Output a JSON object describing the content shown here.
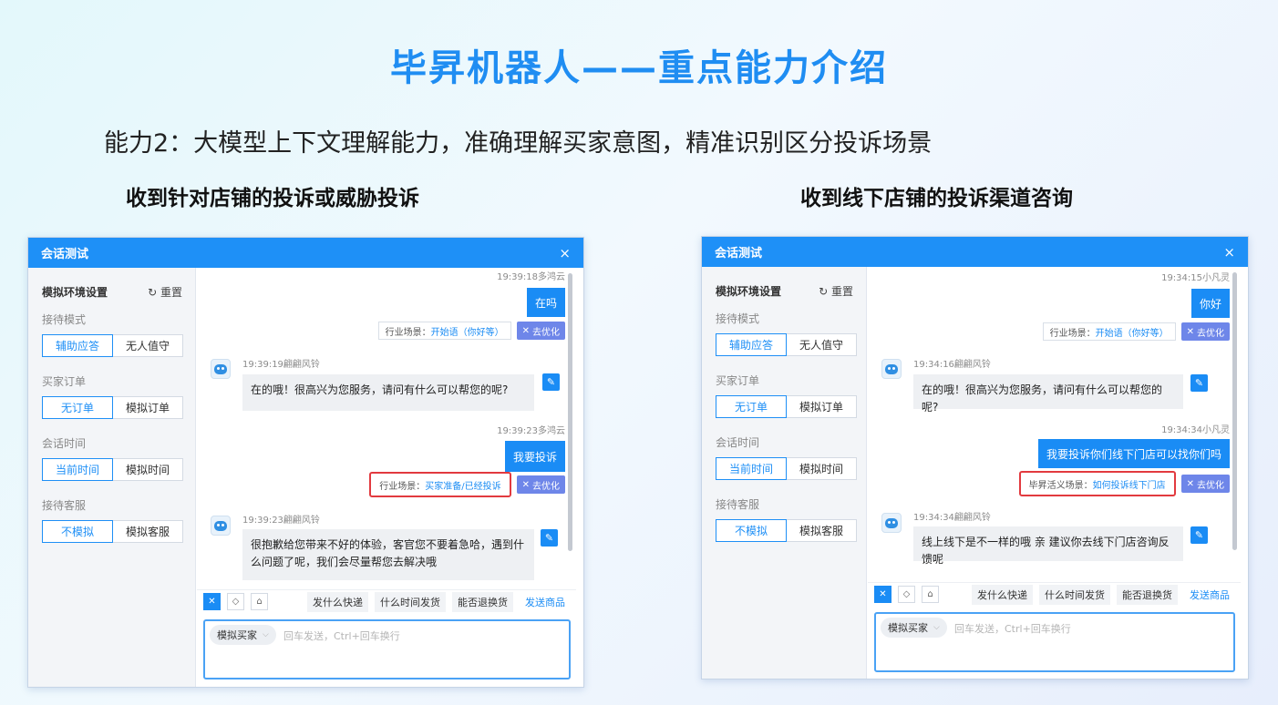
{
  "slide": {
    "title": "毕昇机器人——重点能力介绍",
    "subtitle": "能力2：大模型上下文理解能力，准确理解买家意图，精准识别区分投诉场景",
    "caption_left": "收到针对店铺的投诉或威胁投诉",
    "caption_right": "收到线下店铺的投诉渠道咨询"
  },
  "panels": [
    {
      "title": "会话测试",
      "close": "×",
      "sidebar": {
        "heading": "模拟环境设置",
        "reset": "重置",
        "groups": [
          {
            "label": "接待模式",
            "options": [
              "辅助应答",
              "无人值守"
            ]
          },
          {
            "label": "买家订单",
            "options": [
              "无订单",
              "模拟订单"
            ]
          },
          {
            "label": "会话时间",
            "options": [
              "当前时间",
              "模拟时间"
            ]
          },
          {
            "label": "接待客服",
            "options": [
              "不模拟",
              "模拟客服"
            ]
          }
        ]
      },
      "messages": [
        {
          "role": "buyer",
          "time": "19:39:18多鸿云",
          "text": "在吗",
          "scene_label": "行业场景：",
          "scene_value": "开始语（你好等）",
          "optimize": "去优化"
        },
        {
          "role": "bot",
          "time": "19:39:19翩翩风铃",
          "text": "在的哦！很高兴为您服务，请问有什么可以帮您的呢?"
        },
        {
          "role": "buyer",
          "time": "19:39:23多鸿云",
          "text": "我要投诉",
          "scene_label": "行业场景：",
          "scene_value": "买家准备/已经投诉",
          "optimize": "去优化"
        },
        {
          "role": "bot",
          "time": "19:39:23翩翩风铃",
          "text": "很抱歉给您带来不好的体验，客官您不要着急哈，遇到什么问题了呢，我们会尽量帮您去解决哦"
        }
      ],
      "quick_replies": [
        "发什么快递",
        "什么时间发货",
        "能否退换货"
      ],
      "send_goods": "发送商品",
      "buyer_select": "模拟买家",
      "input_placeholder": "回车发送，Ctrl+回车换行"
    },
    {
      "title": "会话测试",
      "close": "×",
      "sidebar": {
        "heading": "模拟环境设置",
        "reset": "重置",
        "groups": [
          {
            "label": "接待模式",
            "options": [
              "辅助应答",
              "无人值守"
            ]
          },
          {
            "label": "买家订单",
            "options": [
              "无订单",
              "模拟订单"
            ]
          },
          {
            "label": "会话时间",
            "options": [
              "当前时间",
              "模拟时间"
            ]
          },
          {
            "label": "接待客服",
            "options": [
              "不模拟",
              "模拟客服"
            ]
          }
        ]
      },
      "messages": [
        {
          "role": "buyer",
          "time": "19:34:15小凡灵",
          "text": "你好",
          "scene_label": "行业场景：",
          "scene_value": "开始语（你好等）",
          "optimize": "去优化"
        },
        {
          "role": "bot",
          "time": "19:34:16翩翩风铃",
          "text": "在的哦！很高兴为您服务，请问有什么可以帮您的呢?"
        },
        {
          "role": "buyer",
          "time": "19:34:34小凡灵",
          "text": "我要投诉你们线下门店可以找你们吗",
          "scene_label": "毕昇活义场景：",
          "scene_value": "如何投诉线下门店",
          "optimize": "去优化"
        },
        {
          "role": "bot",
          "time": "19:34:34翩翩风铃",
          "text": "线上线下是不一样的哦 亲 建议你去线下门店咨询反馈呢"
        }
      ],
      "quick_replies": [
        "发什么快递",
        "什么时间发货",
        "能否退换货"
      ],
      "send_goods": "发送商品",
      "buyer_select": "模拟买家",
      "input_placeholder": "回车发送，Ctrl+回车换行"
    }
  ],
  "colors": {
    "accent": "#1e90f7",
    "title_blue": "#1f8df2",
    "highlight_red": "#e23a3f",
    "optimize_btn": "#6e86e9"
  }
}
